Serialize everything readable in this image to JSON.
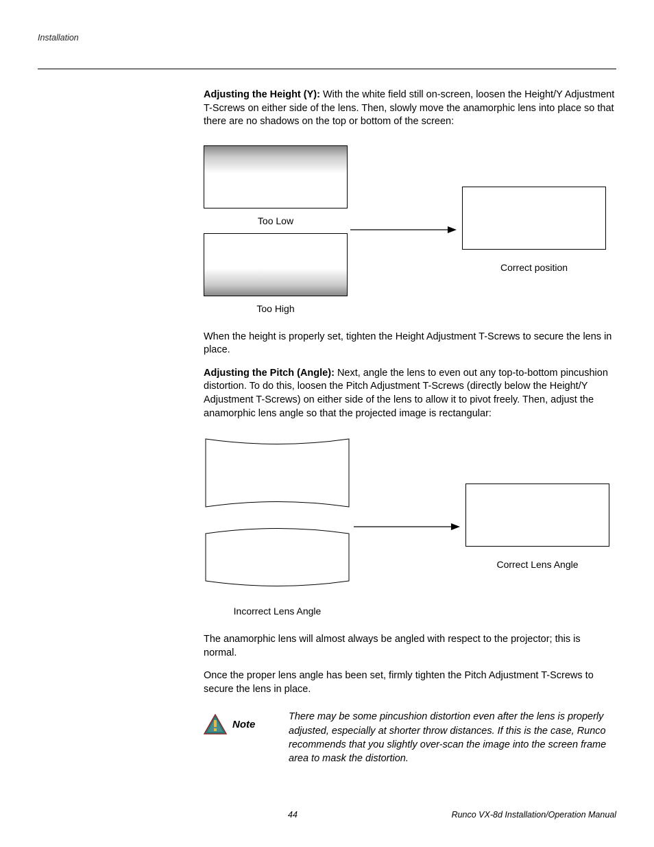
{
  "header": {
    "section_label": "Installation"
  },
  "body": {
    "adj_height_bold": "Adjusting the Height (Y): ",
    "adj_height_text": "With the white field still on-screen, loosen the Height/Y Adjustment T-Screws on either side of the lens. Then, slowly move the anamorphic lens into place so that there are no shadows on the top or bottom of the screen:",
    "too_low": "Too Low",
    "too_high": "Too High",
    "correct_position": "Correct position",
    "height_set_text": "When the height is properly set, tighten the Height Adjustment T-Screws to secure the lens in place.",
    "adj_pitch_bold": "Adjusting the Pitch (Angle): ",
    "adj_pitch_text": "Next, angle the lens to even out any top-to-bottom pincushion distortion. To do this, loosen the Pitch Adjustment T-Screws (directly below the Height/Y Adjustment T-Screws) on either side of the lens to allow it to pivot freely. Then, adjust the anamorphic lens angle so that the projected image is rectangular:",
    "incorrect_lens_angle": "Incorrect Lens Angle",
    "correct_lens_angle": "Correct Lens Angle",
    "anamorphic_text": "The anamorphic lens will almost always be angled with respect to the projector; this is normal.",
    "once_proper_text": "Once the proper lens angle has been set, firmly tighten the Pitch Adjustment T-Screws to secure the lens in place.",
    "note_label": "Note",
    "note_text": "There may be some pincushion distortion even after the lens is properly adjusted, especially at shorter throw distances. If this is the case, Runco recommends that you slightly over-scan the image into the screen frame area to mask the distortion."
  },
  "footer": {
    "page": "44",
    "manual": "Runco VX-8d Installation/Operation Manual"
  }
}
